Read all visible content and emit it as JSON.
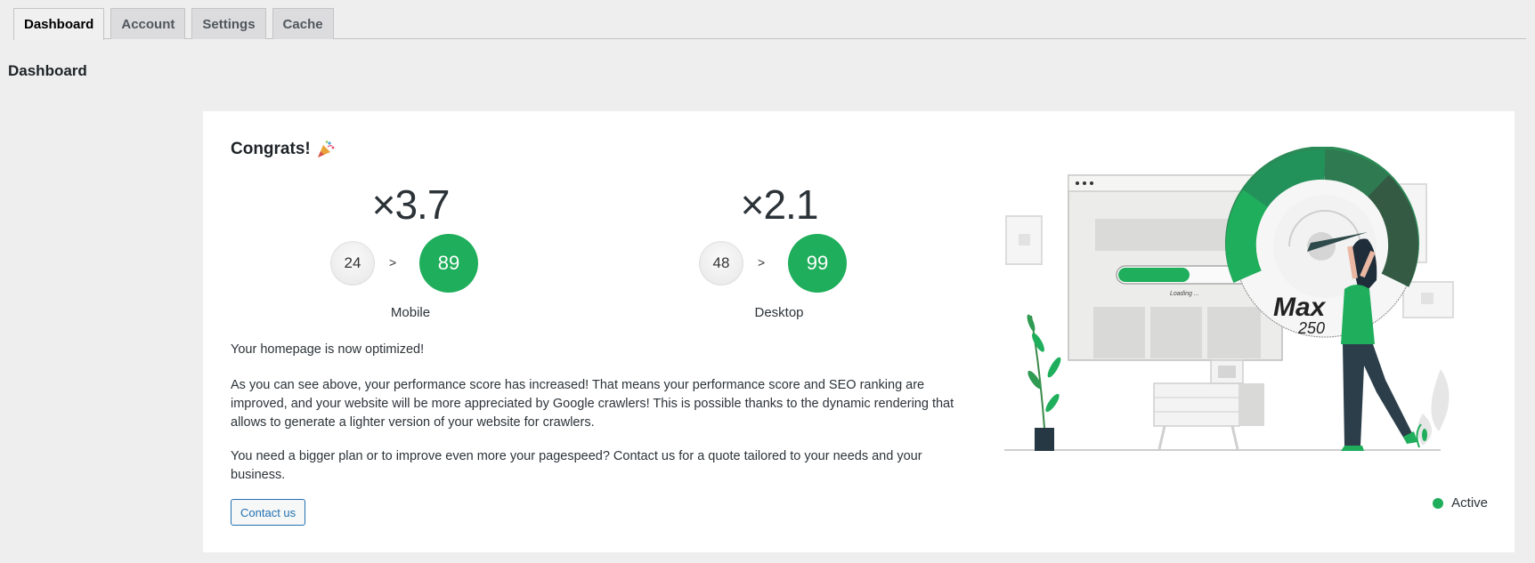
{
  "tabs": [
    {
      "label": "Dashboard",
      "active": true
    },
    {
      "label": "Account",
      "active": false
    },
    {
      "label": "Settings",
      "active": false
    },
    {
      "label": "Cache",
      "active": false
    }
  ],
  "page_title": "Dashboard",
  "card": {
    "congrats": "Congrats!",
    "congrats_icon": "party-popper-icon",
    "mobile": {
      "multiplier": "×3.7",
      "old_score": "24",
      "arrow": ">",
      "new_score": "89",
      "label": "Mobile"
    },
    "desktop": {
      "multiplier": "×2.1",
      "old_score": "48",
      "arrow": ">",
      "new_score": "99",
      "label": "Desktop"
    },
    "paragraph1": "Your homepage is now optimized!",
    "paragraph2": "As you can see above, your performance score has increased! That means your performance score and SEO ranking are improved, and your website will be more appreciated by Google crawlers! This is possible thanks to the dynamic rendering that allows to generate a lighter version of your website for crawlers.",
    "paragraph3": "You need a bigger plan or to improve even more your pagespeed? Contact us for a quote tailored to your needs and your business.",
    "contact_button": "Contact us",
    "illustration": {
      "gauge_text": "Max",
      "gauge_number": "250",
      "loading_text": "Loading ..."
    },
    "status_label": "Active",
    "accent_color": "#1fae5b"
  }
}
